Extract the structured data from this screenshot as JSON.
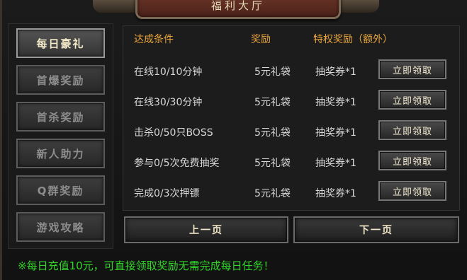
{
  "window": {
    "title": "福利大厅"
  },
  "sidebar": {
    "items": [
      {
        "label": "每日豪礼",
        "active": true
      },
      {
        "label": "首爆奖励",
        "active": false
      },
      {
        "label": "首杀奖励",
        "active": false
      },
      {
        "label": "新人助力",
        "active": false
      },
      {
        "label": "Q群奖励",
        "active": false
      },
      {
        "label": "游戏攻略",
        "active": false
      }
    ]
  },
  "table": {
    "headers": {
      "condition": "达成条件",
      "reward": "奖励",
      "privilege": "特权奖励（额外）"
    },
    "claim_label": "立即领取",
    "rows": [
      {
        "condition": "在线10/10分钟",
        "reward": "5元礼袋",
        "privilege": "抽奖券*1"
      },
      {
        "condition": "在线30/30分钟",
        "reward": "5元礼袋",
        "privilege": "抽奖券*1"
      },
      {
        "condition": "击杀0/50只BOSS",
        "reward": "5元礼袋",
        "privilege": "抽奖券*1"
      },
      {
        "condition": "参与0/5次免费抽奖",
        "reward": "5元礼袋",
        "privilege": "抽奖券*1"
      },
      {
        "condition": "完成0/3次押镖",
        "reward": "5元礼袋",
        "privilege": "抽奖券*1"
      }
    ]
  },
  "paging": {
    "prev": "上一页",
    "next": "下一页"
  },
  "footer": {
    "notice": "※每日充值10元，可直接领取奖励无需完成每日任务！"
  },
  "colors": {
    "header": "#e7a43a",
    "notice": "#33d52b",
    "title_plate": "#6b3528"
  }
}
